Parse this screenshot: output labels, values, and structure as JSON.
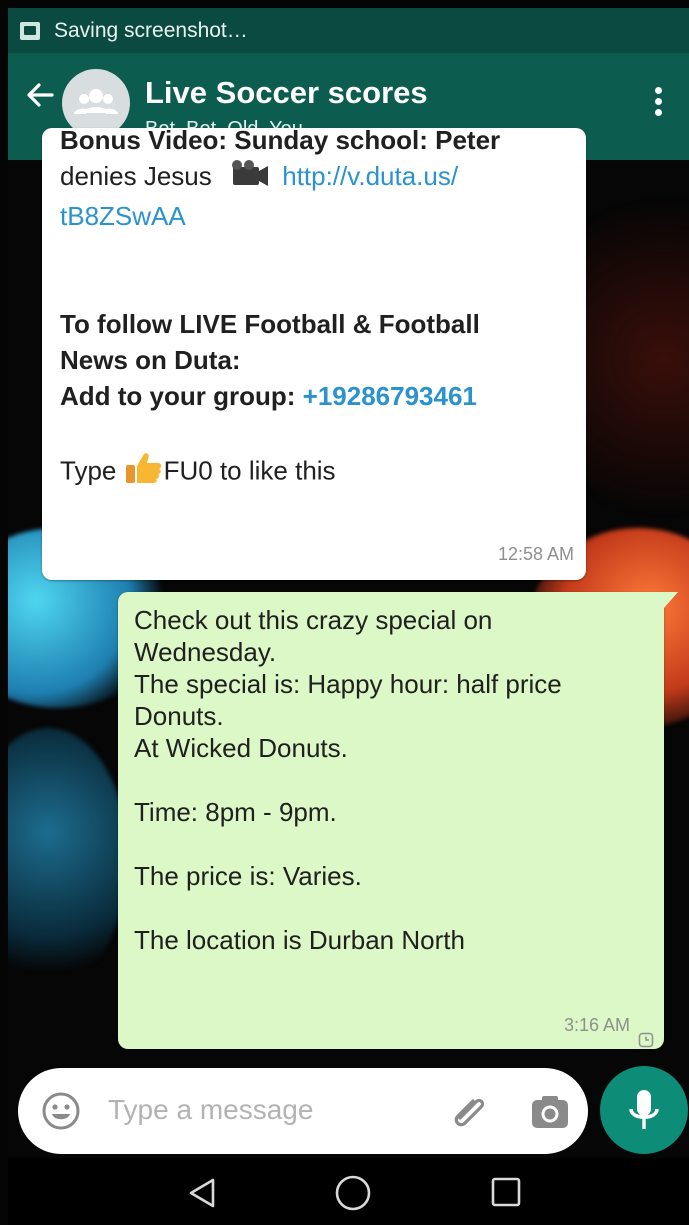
{
  "status_bar": {
    "text": "Saving screenshot…",
    "icon": "screenshot-icon"
  },
  "header": {
    "back_icon": "arrow-left-icon",
    "avatar_icon": "group-avatar-icon",
    "title": "Live Soccer scores",
    "subtitle": "Bot, Bot, Old, You",
    "menu_icon": "more-vertical-icon",
    "color": "#0d5c50"
  },
  "messages": {
    "incoming": {
      "line_partial": "Bonus Video: Sunday school: Peter",
      "line_text": "denies Jesus",
      "video_icon": "video-camera-icon",
      "link_part1": "http://v.duta.us/",
      "link_part2": "tB8ZSwAA",
      "bold_line1": "To follow LIVE Football & Football",
      "bold_line2": "News on Duta:",
      "bold_line3_label": "Add to your group:",
      "phone": "+19286793461",
      "like_prefix": "Type",
      "like_icon": "thumbs-up-icon",
      "like_suffix": "FU0 to like this",
      "time": "12:58 AM"
    },
    "outgoing": {
      "lines": [
        "Check out this crazy special on",
        "Wednesday.",
        "The special is: Happy hour: half price",
        "Donuts.",
        "At Wicked Donuts."
      ],
      "time_line": "Time: 8pm - 9pm.",
      "price_line": "The price is: Varies.",
      "location_line": "The location is Durban North",
      "time": "3:16 AM",
      "status_icon": "clock-pending-icon",
      "color": "#dcf8c6"
    }
  },
  "composer": {
    "emoji_icon": "emoji-icon",
    "placeholder": "Type a message",
    "attach_icon": "paperclip-icon",
    "camera_icon": "camera-icon",
    "mic_icon": "microphone-icon",
    "mic_color": "#0d8d78"
  },
  "navigation": {
    "back": "nav-back-icon",
    "home": "nav-home-icon",
    "recents": "nav-recents-icon"
  }
}
